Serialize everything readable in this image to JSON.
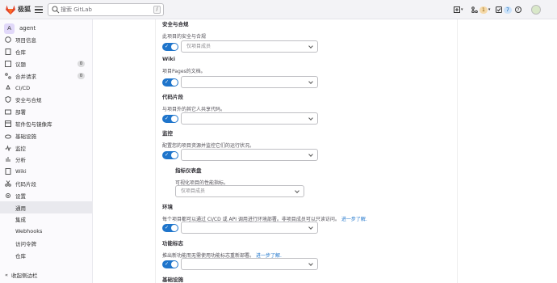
{
  "topbar": {
    "brand": "极狐",
    "search_placeholder": "搜索 GitLab",
    "search_shortcut": "/",
    "merge_count": "1",
    "todo_count": "7"
  },
  "sidebar": {
    "project_initial": "A",
    "project_name": "agent",
    "items": [
      {
        "label": "项目信息",
        "count": ""
      },
      {
        "label": "仓库",
        "count": ""
      },
      {
        "label": "议题",
        "count": "0"
      },
      {
        "label": "合并请求",
        "count": "0"
      },
      {
        "label": "CI/CD",
        "count": ""
      },
      {
        "label": "安全与合规",
        "count": ""
      },
      {
        "label": "部署",
        "count": ""
      },
      {
        "label": "软件包与镜像库",
        "count": ""
      },
      {
        "label": "基础设施",
        "count": ""
      },
      {
        "label": "监控",
        "count": ""
      },
      {
        "label": "分析",
        "count": ""
      },
      {
        "label": "Wiki",
        "count": ""
      },
      {
        "label": "代码片段",
        "count": ""
      },
      {
        "label": "设置",
        "count": ""
      }
    ],
    "sub_items": [
      "通用",
      "集成",
      "Webhooks",
      "访问令牌",
      "仓库"
    ],
    "collapse_label": "收起侧边栏"
  },
  "sections": {
    "security": {
      "title": "安全与合规",
      "desc": "此项目的安全与合规",
      "select": "仅项目成员"
    },
    "wiki": {
      "title": "Wiki",
      "desc": "项目Pages的文档。",
      "select": ""
    },
    "snippets": {
      "title": "代码片段",
      "desc": "与项目外的其它人共享代码。",
      "select": ""
    },
    "monitor": {
      "title": "监控",
      "desc": "配置您的项目资源并监控它们的运行状况。",
      "select": ""
    },
    "metrics": {
      "title": "指标仪表盘",
      "desc": "可视化项目的性能指标。",
      "select": "仅项目成员"
    },
    "env": {
      "title": "环境",
      "desc": "每个项目都可以通过 CI/CD 或 API 调用进行环境部署。非项目成员可以只读访问。",
      "link": "进一步了解.",
      "select": ""
    },
    "flags": {
      "title": "功能标志",
      "desc": "推出新功能而无需使用功能标志重新部署。",
      "link": "进一步了解.",
      "select": ""
    },
    "infra": {
      "title": "基础设施"
    }
  }
}
